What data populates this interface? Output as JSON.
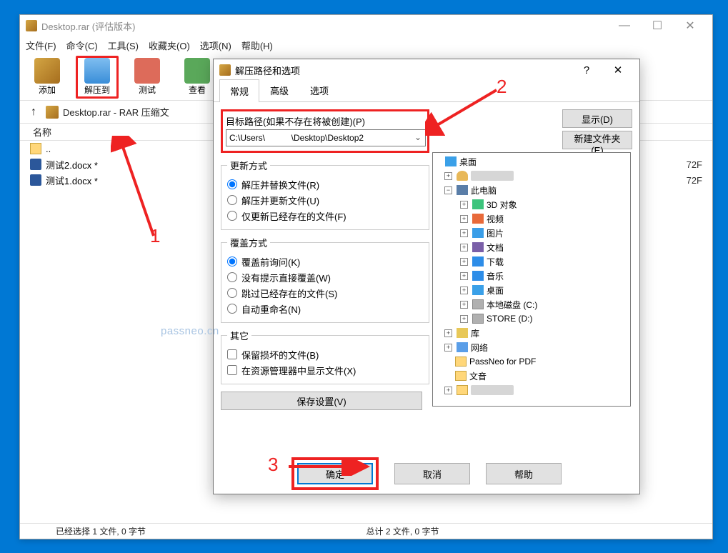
{
  "main_window": {
    "title": "Desktop.rar (评估版本)",
    "menu": [
      "文件(F)",
      "命令(C)",
      "工具(S)",
      "收藏夹(O)",
      "选项(N)",
      "帮助(H)"
    ],
    "tools": {
      "add": "添加",
      "extract_to": "解压到",
      "test": "测试",
      "view": "查看"
    },
    "address_path": "Desktop.rar - RAR 压缩文",
    "column_name": "名称",
    "files": {
      "up": "..",
      "f1": "测试2.docx *",
      "f2": "测试1.docx *",
      "size1": "72F",
      "size2": "72F"
    },
    "status_left": "已经选择 1 文件, 0 字节",
    "status_right": "总计 2 文件, 0 字节"
  },
  "dialog": {
    "title": "解压路径和选项",
    "tabs": {
      "general": "常规",
      "advanced": "高级",
      "options": "选项"
    },
    "path_label": "目标路径(如果不存在将被创建)(P)",
    "path_value": "C:\\Users\\           \\Desktop\\Desktop2",
    "btn_show": "显示(D)",
    "btn_newfolder": "新建文件夹(E)",
    "group_update": "更新方式",
    "update": {
      "r1": "解压并替换文件(R)",
      "r2": "解压并更新文件(U)",
      "r3": "仅更新已经存在的文件(F)"
    },
    "group_overwrite": "覆盖方式",
    "overwrite": {
      "r1": "覆盖前询问(K)",
      "r2": "没有提示直接覆盖(W)",
      "r3": "跳过已经存在的文件(S)",
      "r4": "自动重命名(N)"
    },
    "group_misc": "其它",
    "misc": {
      "c1": "保留损坏的文件(B)",
      "c2": "在资源管理器中显示文件(X)"
    },
    "btn_save": "保存设置(V)",
    "tree": {
      "desktop": "桌面",
      "user_blur": "xxxxxx",
      "thispc": "此电脑",
      "obj3d": "3D 对象",
      "video": "视频",
      "pic": "图片",
      "doc": "文档",
      "download": "下载",
      "music": "音乐",
      "desktop2": "桌面",
      "cdisk": "本地磁盘 (C:)",
      "ddisk": "STORE (D:)",
      "lib": "库",
      "network": "网络",
      "passneo": "PassNeo for PDF",
      "f2": "文音",
      "blur": "xxxxxx"
    },
    "btn_ok": "确定",
    "btn_cancel": "取消",
    "btn_help": "帮助"
  },
  "annotations": {
    "n1": "1",
    "n2": "2",
    "n3": "3"
  },
  "watermark": "passneo.cn"
}
